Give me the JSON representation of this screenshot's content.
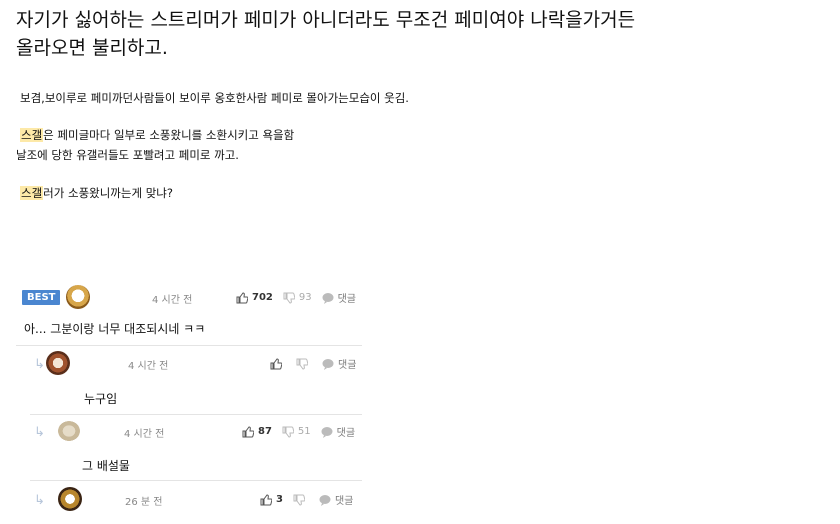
{
  "post": {
    "title_line1": "자기가 싫어하는 스트리머가 페미가 아니더라도 무조건 페미여야 나락을가거든",
    "title_line2": "올라오면 불리하고.",
    "p1": "보겸,보이루로 페미까던사람들이   보이루 옹호한사람 페미로 몰아가는모습이 웃김.",
    "p2_hl": "스갤",
    "p2_rest": "은 페미글마다 일부로 소풍왔니를 소환시키고 욕을함",
    "p3": "날조에 당한 유갤러들도 포빨려고 페미로 까고.",
    "p4_hl": "스갤",
    "p4_rest": "러가 소풍왔니까는게 맞냐?"
  },
  "comments": {
    "best_badge": "BEST",
    "main": {
      "time": "4 시간 전",
      "likes": "702",
      "dislikes": "93",
      "reply_label": "댓글",
      "text": "아... 그분이랑 너무 대조되시네 ㅋㅋ"
    },
    "replies": [
      {
        "time": "4 시간 전",
        "likes": "",
        "dislikes": "",
        "reply_label": "댓글",
        "text": "누구임"
      },
      {
        "time": "4 시간 전",
        "likes": "87",
        "dislikes": "51",
        "reply_label": "댓글",
        "text": "그 배설물"
      },
      {
        "time": "26 분 전",
        "likes": "3",
        "dislikes": "",
        "reply_label": "댓글",
        "text": ""
      }
    ]
  },
  "colors": {
    "highlight": "#fde9a8",
    "best_badge": "#4a86d0"
  },
  "icons": [
    "thumbs-up-icon",
    "thumbs-down-icon",
    "speech-bubble-icon",
    "reply-arrow-icon"
  ]
}
